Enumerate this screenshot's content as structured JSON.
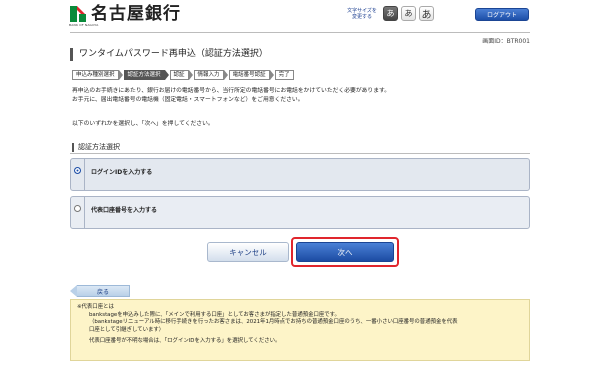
{
  "header": {
    "bank_name": "名古屋銀行",
    "bank_name_en": "BANK OF NAGOYA",
    "font_size_label": "文字サイズを変更する",
    "font_size_options": [
      "あ",
      "あ",
      "あ"
    ],
    "logout_label": "ログアウト"
  },
  "screen_id": "画面ID：BTR001",
  "page_title": "ワンタイムパスワード再申込（認証方法選択）",
  "steps": [
    {
      "label": "申込み種別選択",
      "active": false
    },
    {
      "label": "認証方法選択",
      "active": true
    },
    {
      "label": "認証",
      "active": false
    },
    {
      "label": "情報入力",
      "active": false
    },
    {
      "label": "電話番号認証",
      "active": false
    },
    {
      "label": "完了",
      "active": false
    }
  ],
  "description": {
    "line1": "再申込のお手続きにあたり、銀行お届けの電話番号から、当行所定の電話番号にお電話をかけていただく必要があります。",
    "line2": "お手元に、届出電話番号の電話機（固定電話・スマートフォンなど）をご用意ください。",
    "line3": "以下のいずれかを選択し、「次へ」を押してください。"
  },
  "section_title": "認証方法選択",
  "options": [
    {
      "label": "ログインIDを入力する",
      "selected": true
    },
    {
      "label": "代表口座番号を入力する",
      "selected": false
    }
  ],
  "buttons": {
    "cancel": "キャンセル",
    "next": "次へ",
    "back": "戻る"
  },
  "note": {
    "line1": "※代表口座とは",
    "line2": "bankstageを申込みした際に、「メインで利用する口座」としてお客さまが指定した普通預金口座です。",
    "line3": "（bankstageリニューアル時に移行手続きを行ったお客さまは、2021年1月時点でお持ちの普通預金口座のうち、一番小さい口座番号の普通預金を代表",
    "line4": "口座として引継ぎしています）",
    "line5": "代表口座番号が不明な場合は、「ログインIDを入力する」を選択してください。"
  },
  "colors": {
    "accent_blue": "#1d4fa8",
    "highlight_red": "#e0262d",
    "brand_green": "#0a8a3a"
  }
}
